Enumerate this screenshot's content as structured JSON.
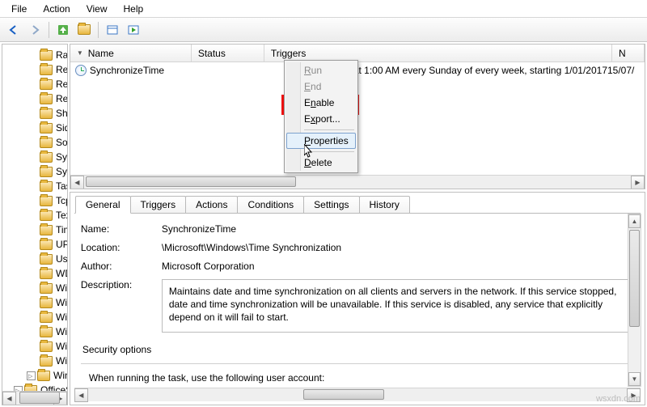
{
  "menubar": {
    "file": "File",
    "action": "Action",
    "view": "View",
    "help": "Help"
  },
  "tree": {
    "items": [
      {
        "label": "Ras"
      },
      {
        "label": "Registry"
      },
      {
        "label": "RemoteApp and D"
      },
      {
        "label": "RemoteAssistance"
      },
      {
        "label": "Shell"
      },
      {
        "label": "SideShow"
      },
      {
        "label": "SoftwareProtection"
      },
      {
        "label": "SyncCenter"
      },
      {
        "label": "SystemRestore"
      },
      {
        "label": "Task Manager"
      },
      {
        "label": "Tcpip"
      },
      {
        "label": "TextServicesFrame"
      },
      {
        "label": "Time Synchronizat"
      },
      {
        "label": "UPnP"
      },
      {
        "label": "User Profile Servic"
      },
      {
        "label": "WDI"
      },
      {
        "label": "Windows Activatio"
      },
      {
        "label": "Windows Error Rep"
      },
      {
        "label": "Windows Filtering"
      },
      {
        "label": "Windows Media Sh"
      },
      {
        "label": "WindowsBackup"
      },
      {
        "label": "WindowsColorSys"
      }
    ],
    "defender": "Windows Defender",
    "office": "OfficeSoftwareProtection"
  },
  "task_list": {
    "cols": {
      "name": "Name",
      "status": "Status",
      "triggers": "Triggers",
      "next": "N"
    },
    "row": {
      "name": "SynchronizeTime",
      "triggers": "at 1:00 AM every Sunday of every week, starting 1/01/2017",
      "date": "15/07/"
    }
  },
  "ctx": {
    "run_pre": "",
    "run_ul": "R",
    "run_post": "un",
    "end_pre": "",
    "end_ul": "E",
    "end_post": "nd",
    "enable_pre": "E",
    "enable_ul": "n",
    "enable_post": "able",
    "export_pre": "E",
    "export_ul": "x",
    "export_post": "port...",
    "props_pre": "",
    "props_ul": "P",
    "props_post": "roperties",
    "delete_pre": "",
    "delete_ul": "D",
    "delete_post": "elete"
  },
  "tabs": {
    "general": "General",
    "triggers": "Triggers",
    "actions": "Actions",
    "conditions": "Conditions",
    "settings": "Settings",
    "history": "History"
  },
  "details": {
    "name_label": "Name:",
    "name_value": "SynchronizeTime",
    "loc_label": "Location:",
    "loc_value": "\\Microsoft\\Windows\\Time Synchronization",
    "author_label": "Author:",
    "author_value": "Microsoft Corporation",
    "desc_label": "Description:",
    "desc_value": "Maintains date and time synchronization on all clients and servers in the network. If this service stopped, date and time synchronization will be unavailable. If this service is disabled, any service that explicitly depend on it will fail to start.",
    "sec_header": "Security options",
    "sec_line": "When running the task, use the following user account:"
  },
  "watermark": "wsxdn.com"
}
